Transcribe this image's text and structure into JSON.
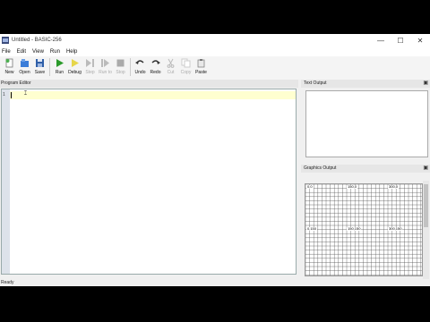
{
  "window": {
    "title": "Untitled - BASIC-256",
    "controls": [
      "—",
      "☐",
      "✕"
    ]
  },
  "menu": [
    "File",
    "Edit",
    "View",
    "Run",
    "Help"
  ],
  "toolbar": [
    {
      "label": "New",
      "icon": "new-icon",
      "enabled": true
    },
    {
      "label": "Open",
      "icon": "open-icon",
      "enabled": true
    },
    {
      "label": "Save",
      "icon": "save-icon",
      "enabled": true
    },
    {
      "label": "Run",
      "icon": "run-icon",
      "enabled": true
    },
    {
      "label": "Debug",
      "icon": "debug-icon",
      "enabled": true
    },
    {
      "label": "Step",
      "icon": "step-icon",
      "enabled": false
    },
    {
      "label": "Run to",
      "icon": "run-to-icon",
      "enabled": false
    },
    {
      "label": "Stop",
      "icon": "stop-icon",
      "enabled": false
    },
    {
      "label": "Undo",
      "icon": "undo-icon",
      "enabled": true
    },
    {
      "label": "Redo",
      "icon": "redo-icon",
      "enabled": true
    },
    {
      "label": "Cut",
      "icon": "cut-icon",
      "enabled": false
    },
    {
      "label": "Copy",
      "icon": "copy-icon",
      "enabled": false
    },
    {
      "label": "Paste",
      "icon": "paste-icon",
      "enabled": true
    }
  ],
  "editor": {
    "header": "Program Editor",
    "line_number": "1",
    "content": ""
  },
  "text_output": {
    "header": "Text Output",
    "pin_icon": "pin-icon"
  },
  "graphics_output": {
    "header": "Graphics Output",
    "coords": {
      "top_left": "0,0",
      "top_mid": "150,0",
      "top_right": "300,0",
      "mid_left": "0,150",
      "center": "150,150",
      "mid_right": "300,150"
    }
  },
  "status": "Ready",
  "colors": {
    "current_line": "#ffffd0",
    "gutter": "#dde2ea",
    "run_green": "#2a9a2a"
  }
}
